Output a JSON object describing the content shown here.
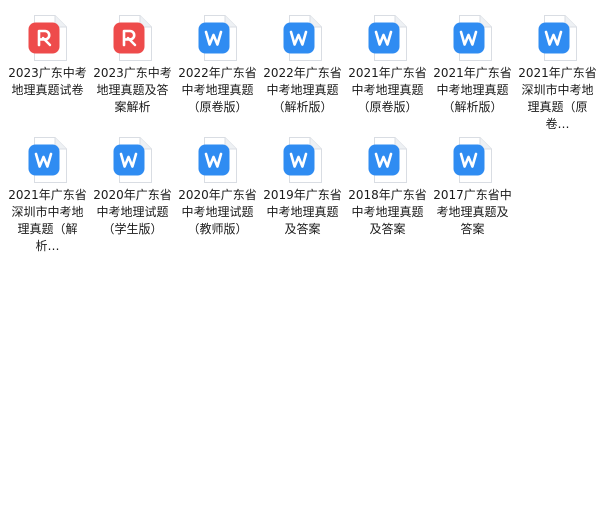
{
  "files": [
    {
      "name": "2023广东中考地理真题试卷",
      "type": "pdf",
      "icon": "pdf-file-icon"
    },
    {
      "name": "2023广东中考地理真题及答案解析",
      "type": "pdf",
      "icon": "pdf-file-icon"
    },
    {
      "name": "2022年广东省中考地理真题（原卷版）",
      "type": "word",
      "icon": "word-file-icon"
    },
    {
      "name": "2022年广东省中考地理真题（解析版）",
      "type": "word",
      "icon": "word-file-icon"
    },
    {
      "name": "2021年广东省中考地理真题（原卷版）",
      "type": "word",
      "icon": "word-file-icon"
    },
    {
      "name": "2021年广东省中考地理真题（解析版）",
      "type": "word",
      "icon": "word-file-icon"
    },
    {
      "name": "2021年广东省深圳市中考地理真题（原卷…",
      "type": "word",
      "icon": "word-file-icon"
    },
    {
      "name": "2021年广东省深圳市中考地理真题（解析…",
      "type": "word",
      "icon": "word-file-icon"
    },
    {
      "name": "2020年广东省中考地理试题（学生版）",
      "type": "word",
      "icon": "word-file-icon"
    },
    {
      "name": "2020年广东省中考地理试题（教师版）",
      "type": "word",
      "icon": "word-file-icon"
    },
    {
      "name": "2019年广东省中考地理真题及答案",
      "type": "word",
      "icon": "word-file-icon"
    },
    {
      "name": "2018年广东省中考地理真题及答案",
      "type": "word",
      "icon": "word-file-icon"
    },
    {
      "name": "2017广东省中考地理真题及答案",
      "type": "word",
      "icon": "word-file-icon"
    }
  ],
  "colors": {
    "pdf": "#ee4b4b",
    "word": "#2f8cf2",
    "page": "#ffffff",
    "page_border": "#d9dde3",
    "fold": "#eef1f4"
  }
}
